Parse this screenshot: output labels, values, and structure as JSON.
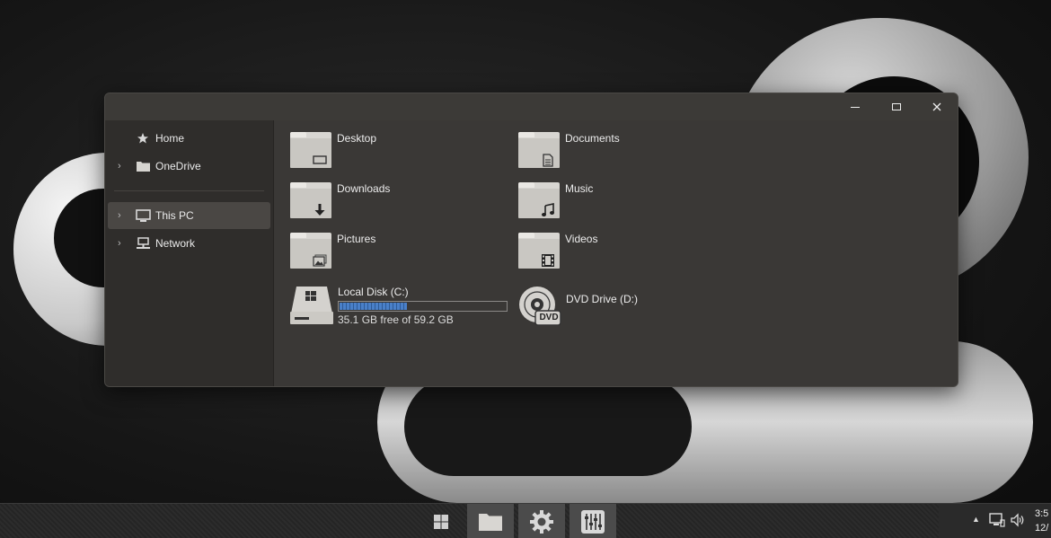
{
  "window": {
    "controls": {
      "minimize_icon": "minimize-icon",
      "maximize_icon": "maximize-icon",
      "close_icon": "close-icon"
    }
  },
  "sidebar": {
    "items": [
      {
        "label": "Home",
        "icon": "star-icon",
        "has_chevron": false,
        "selected": false
      },
      {
        "label": "OneDrive",
        "icon": "folder-icon",
        "has_chevron": true,
        "selected": false
      },
      {
        "label": "This PC",
        "icon": "monitor-icon",
        "has_chevron": true,
        "selected": true
      },
      {
        "label": "Network",
        "icon": "network-icon",
        "has_chevron": true,
        "selected": false
      }
    ]
  },
  "folders": [
    {
      "label": "Desktop",
      "icon": "desktop-folder-icon"
    },
    {
      "label": "Documents",
      "icon": "documents-folder-icon"
    },
    {
      "label": "Downloads",
      "icon": "downloads-folder-icon"
    },
    {
      "label": "Music",
      "icon": "music-folder-icon"
    },
    {
      "label": "Pictures",
      "icon": "pictures-folder-icon"
    },
    {
      "label": "Videos",
      "icon": "videos-folder-icon"
    }
  ],
  "drives": [
    {
      "label": "Local Disk (C:)",
      "free_text": "35.1 GB free of 59.2 GB",
      "used_fraction": 0.407,
      "icon": "hard-drive-icon"
    },
    {
      "label": "DVD Drive (D:)",
      "icon": "dvd-drive-icon",
      "badge": "DVD"
    }
  ],
  "taskbar": {
    "buttons": [
      {
        "name": "start-button",
        "icon": "windows-start-icon",
        "active": false
      },
      {
        "name": "file-explorer-button",
        "icon": "folder-icon",
        "active": true
      },
      {
        "name": "settings-button",
        "icon": "gear-icon",
        "active": true
      },
      {
        "name": "mixer-button",
        "icon": "sliders-icon",
        "active": true
      }
    ],
    "tray": {
      "chevron": "▲",
      "clock_time": "3:5",
      "clock_date": "12/"
    }
  },
  "colors": {
    "window_bg": "#3a3836",
    "sidebar_bg": "#2f2d2b",
    "selection": "#4a4744",
    "drive_bar_fill": "#4a80c8"
  }
}
